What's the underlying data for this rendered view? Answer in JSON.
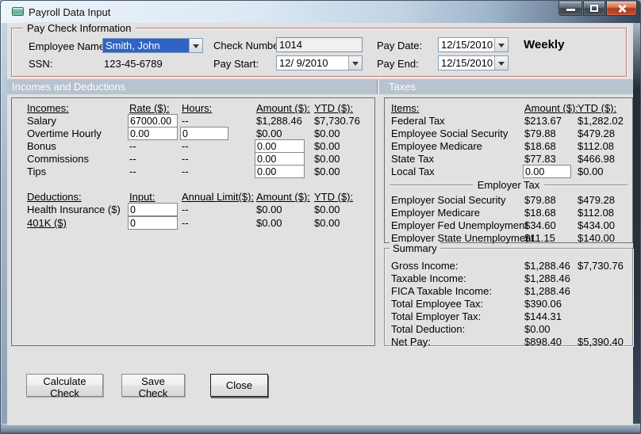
{
  "window": {
    "title": "Payroll Data Input"
  },
  "paycheck": {
    "group_label": "Pay Check Information",
    "employee_name_label": "Employee Name:",
    "employee_name_value": "Smith, John",
    "ssn_label": "SSN:",
    "ssn_value": "123-45-6789",
    "check_number_label": "Check Number:",
    "check_number_value": "1014",
    "pay_start_label": "Pay Start:",
    "pay_start_value": "12/ 9/2010",
    "pay_date_label": "Pay Date:",
    "pay_date_value": "12/15/2010",
    "pay_end_label": "Pay End:",
    "pay_end_value": "12/15/2010",
    "frequency": "Weekly"
  },
  "sections": {
    "left": "Incomes and Deductions",
    "right": "Taxes"
  },
  "incomes": {
    "headers": {
      "c1": "Incomes:",
      "c2": "Rate ($):",
      "c3": "Hours:",
      "c4": "Amount ($):",
      "c5": "YTD ($):"
    },
    "salary": {
      "label": "Salary",
      "rate": "67000.00",
      "hours": "--",
      "amount": "$1,288.46",
      "ytd": "$7,730.76"
    },
    "overtime": {
      "label": "Overtime Hourly",
      "rate": "0.00",
      "hours": "0",
      "amount": "$0.00",
      "ytd": "$0.00"
    },
    "bonus": {
      "label": "Bonus",
      "rate": "--",
      "hours": "--",
      "amount": "0.00",
      "ytd": "$0.00"
    },
    "commissions": {
      "label": "Commissions",
      "rate": "--",
      "hours": "--",
      "amount": "0.00",
      "ytd": "$0.00"
    },
    "tips": {
      "label": "Tips",
      "rate": "--",
      "hours": "--",
      "amount": "0.00",
      "ytd": "$0.00"
    }
  },
  "deductions": {
    "headers": {
      "c1": "Deductions:",
      "c2": "Input:",
      "c3": "Annual Limit($):",
      "c4": "Amount ($):",
      "c5": "YTD ($):"
    },
    "health": {
      "label": "Health Insurance ($)",
      "input": "0",
      "limit": "--",
      "amount": "$0.00",
      "ytd": "$0.00"
    },
    "k401": {
      "label": "401K ($)",
      "input": "0",
      "limit": "--",
      "amount": "$0.00",
      "ytd": "$0.00"
    }
  },
  "taxes": {
    "headers": {
      "c1": "Items:",
      "c2": "Amount ($):",
      "c3": "YTD ($):"
    },
    "rows": [
      {
        "label": "Federal Tax",
        "amount": "$213.67",
        "ytd": "$1,282.02"
      },
      {
        "label": "Employee Social Security",
        "amount": "$79.88",
        "ytd": "$479.28"
      },
      {
        "label": "Employee Medicare",
        "amount": "$18.68",
        "ytd": "$112.08"
      },
      {
        "label": "State Tax",
        "amount": "$77.83",
        "ytd": "$466.98"
      }
    ],
    "local": {
      "label": "Local Tax",
      "amount_input": "0.00",
      "ytd": "$0.00"
    },
    "employer_header": "Employer Tax",
    "employer_rows": [
      {
        "label": "Employer Social Security",
        "amount": "$79.88",
        "ytd": "$479.28"
      },
      {
        "label": "Employer Medicare",
        "amount": "$18.68",
        "ytd": "$112.08"
      },
      {
        "label": "Employer Fed Unemployment",
        "amount": "$34.60",
        "ytd": "$434.00"
      },
      {
        "label": "Employer State Unemployment",
        "amount": "$11.15",
        "ytd": "$140.00"
      }
    ]
  },
  "summary": {
    "group_label": "Summary",
    "rows": [
      {
        "label": "Gross Income:",
        "amount": "$1,288.46",
        "ytd": "$7,730.76"
      },
      {
        "label": "Taxable Income:",
        "amount": "$1,288.46",
        "ytd": ""
      },
      {
        "label": "FICA Taxable Income:",
        "amount": "$1,288.46",
        "ytd": ""
      },
      {
        "label": "Total Employee Tax:",
        "amount": "$390.06",
        "ytd": ""
      },
      {
        "label": "Total Employer Tax:",
        "amount": "$144.31",
        "ytd": ""
      },
      {
        "label": "Total Deduction:",
        "amount": "$0.00",
        "ytd": ""
      },
      {
        "label": "Net Pay:",
        "amount": "$898.40",
        "ytd": "$5,390.40"
      }
    ]
  },
  "buttons": {
    "calculate": "Calculate Check",
    "save": "Save Check",
    "close": "Close"
  },
  "colors": {
    "selection_blue": "#2F63C4",
    "group_border_red": "#BE7A7A",
    "section_band": "#B7C3CF",
    "close_red": "#AE3A1E"
  }
}
